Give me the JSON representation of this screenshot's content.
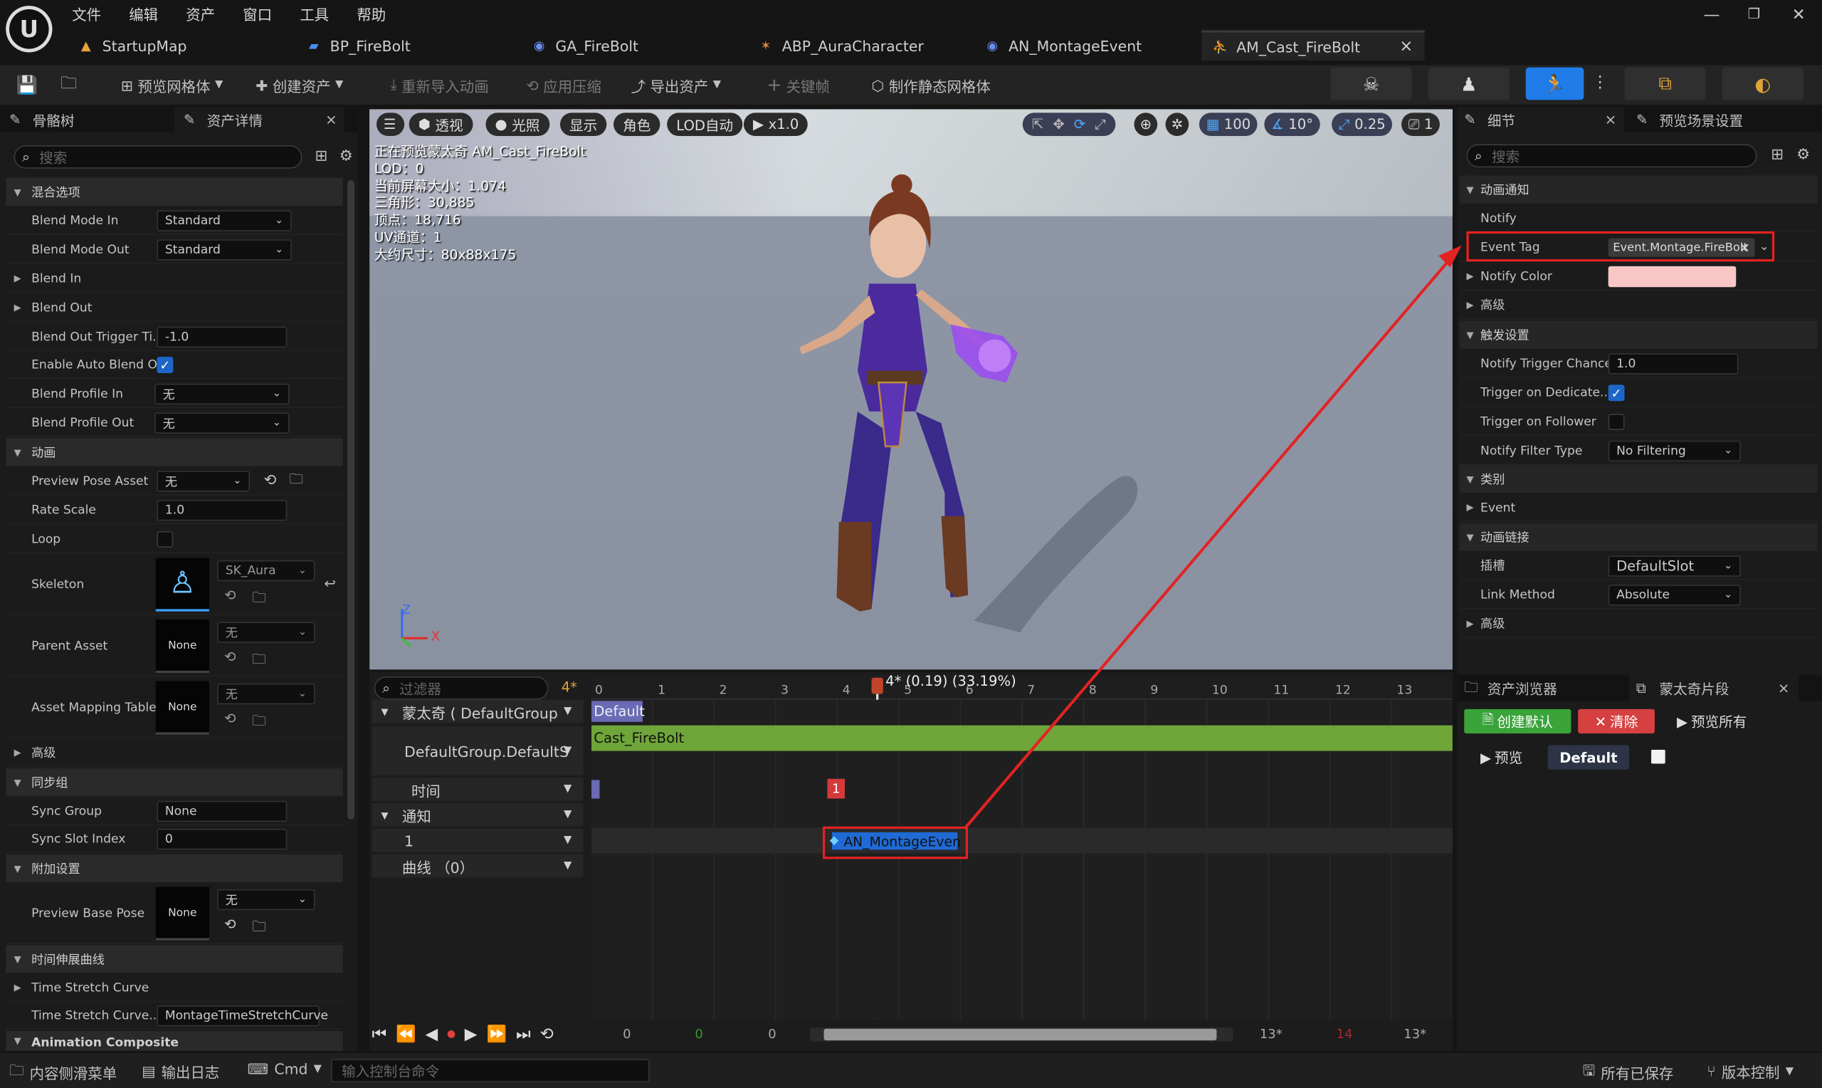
{
  "menu": [
    "文件",
    "编辑",
    "资产",
    "窗口",
    "工具",
    "帮助"
  ],
  "tabs": [
    {
      "label": "StartupMap",
      "icon": "map-icon"
    },
    {
      "label": "BP_FireBolt",
      "icon": "blueprint-icon"
    },
    {
      "label": "GA_FireBolt",
      "icon": "ability-icon"
    },
    {
      "label": "ABP_AuraCharacter",
      "icon": "anim-blueprint-icon"
    },
    {
      "label": "AN_MontageEvent",
      "icon": "notify-icon"
    },
    {
      "label": "AM_Cast_FireBolt",
      "icon": "montage-icon",
      "close": "×"
    }
  ],
  "toolbar": {
    "preview_mesh": "预览网格体",
    "create_asset": "创建资产",
    "reimport": "重新导入动画",
    "apply_compression": "应用压缩",
    "export_asset": "导出资产",
    "keyframe": "关键帧",
    "make_static_mesh": "制作静态网格体"
  },
  "left_panel": {
    "tab_skeleton": "骨骼树",
    "tab_details": "资产详情",
    "close": "×",
    "search_placeholder": "搜索",
    "sections": {
      "blend": "混合选项",
      "anim": "动画",
      "sync": "同步组",
      "additive": "附加设置",
      "time_stretch": "时间伸展曲线",
      "anim_composite": "Animation Composite",
      "advanced": "高级"
    },
    "rows": {
      "blend_mode_in": "Blend Mode In",
      "blend_mode_in_val": "Standard",
      "blend_mode_out": "Blend Mode Out",
      "blend_mode_out_val": "Standard",
      "blend_in": "Blend In",
      "blend_out": "Blend Out",
      "blend_out_trigger": "Blend Out Trigger Ti...",
      "blend_out_trigger_val": "-1.0",
      "enable_auto_blend": "Enable Auto Blend O...",
      "blend_profile_in": "Blend Profile In",
      "blend_profile_in_val": "无",
      "blend_profile_out": "Blend Profile Out",
      "blend_profile_out_val": "无",
      "preview_pose": "Preview Pose Asset",
      "preview_pose_val": "无",
      "rate_scale": "Rate Scale",
      "rate_scale_val": "1.0",
      "loop": "Loop",
      "skeleton": "Skeleton",
      "skeleton_val": "SK_Aura",
      "parent_asset": "Parent Asset",
      "parent_asset_thumb": "None",
      "parent_asset_val": "无",
      "asset_mapping": "Asset Mapping Table",
      "asset_mapping_thumb": "None",
      "asset_mapping_val": "无",
      "sync_group": "Sync Group",
      "sync_group_val": "None",
      "sync_slot": "Sync Slot Index",
      "sync_slot_val": "0",
      "preview_base": "Preview Base Pose",
      "preview_base_thumb": "None",
      "preview_base_val": "无",
      "time_stretch_curve": "Time Stretch Curve",
      "time_stretch_curve2": "Time Stretch Curve...",
      "time_stretch_curve2_val": "MontageTimeStretchCurve"
    }
  },
  "viewport": {
    "buttons": [
      "透视",
      "光照",
      "显示",
      "角色",
      "LOD自动",
      "x1.0"
    ],
    "grid_size": "100",
    "rotation_snap": "10°",
    "scale_snap": "0.25",
    "camera_speed": "1",
    "info": [
      "正在预览蒙太奇 AM_Cast_FireBolt",
      "LOD：0",
      "当前屏幕大小：1.074",
      "三角形：30,885",
      "顶点：18,716",
      "UV通道：1",
      "大约尺寸：80x88x175"
    ],
    "axis_z": "Z",
    "axis_x": "X"
  },
  "sequencer": {
    "filter_placeholder": "过滤器",
    "add": "4*",
    "playhead": "4* (0.19) (33.19%)",
    "ticks": [
      "0",
      "1",
      "2",
      "3",
      "4",
      "5",
      "6",
      "7",
      "8",
      "9",
      "10",
      "11",
      "12",
      "13"
    ],
    "tracks": {
      "montage": "蒙太奇 ( DefaultGroup",
      "slot": "DefaultGroup.DefaultS",
      "time": "时间",
      "notify": "通知",
      "notify_1": "1",
      "curves": "曲线 （0）"
    },
    "section_default": "Default",
    "segment": "Cast_FireBolt",
    "time_marker": "1",
    "notify_event": "AN_MontageEven",
    "transport": {
      "start": "0",
      "green": "0",
      "current": "0",
      "end": "13*",
      "red": "14",
      "end2": "13*"
    }
  },
  "right_panel": {
    "tab_details": "细节",
    "close": "×",
    "tab_preview": "预览场景设置",
    "search_placeholder": "搜索",
    "sections": {
      "anim_notify": "动画通知",
      "trigger": "触发设置",
      "category": "类别",
      "anim_link": "动画链接",
      "advanced": "高级"
    },
    "rows": {
      "notify": "Notify",
      "event_tag": "Event Tag",
      "event_tag_val": "Event.Montage.FireBolt",
      "notify_color": "Notify Color",
      "trigger_chance": "Notify Trigger Chance",
      "trigger_chance_val": "1.0",
      "trigger_dedicated": "Trigger on Dedicate...",
      "trigger_follower": "Trigger on Follower",
      "filter_type": "Notify Filter Type",
      "filter_type_val": "No Filtering",
      "event": "Event",
      "slot": "插槽",
      "slot_val": "DefaultSlot",
      "link_method": "Link Method",
      "link_method_val": "Absolute"
    },
    "notify_color": "#f9c6c6",
    "asset_browser": "资产浏览器",
    "montage_sections": "蒙太奇片段",
    "create_default": "创建默认",
    "clear": "清除",
    "preview_all": "预览所有",
    "preview": "预览",
    "default": "Default"
  },
  "statusbar": {
    "content_drawer": "内容侧滑菜单",
    "output_log": "输出日志",
    "cmd": "Cmd",
    "console_placeholder": "输入控制台命令",
    "all_saved": "所有已保存",
    "source_control": "版本控制"
  },
  "colors": {
    "accent": "#3ca0ff",
    "segment": "#6fa63a",
    "highlight": "#e32222",
    "notify_color": "#f9c6c6"
  }
}
